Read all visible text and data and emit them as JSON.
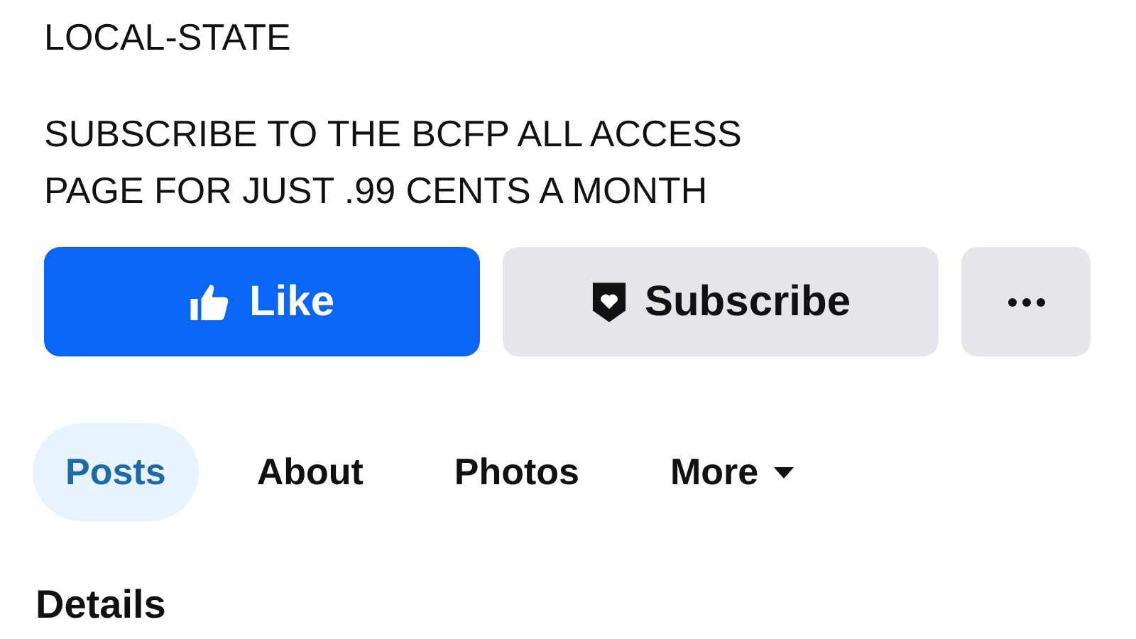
{
  "category": "LOCAL-STATE",
  "description": "SUBSCRIBE TO THE BCFP ALL ACCESS PAGE FOR JUST .99 CENTS A MONTH",
  "actions": [
    {
      "kind": "like",
      "label": "Like"
    },
    {
      "kind": "subscribe",
      "label": "Subscribe"
    },
    {
      "kind": "more"
    }
  ],
  "tabs": [
    {
      "label": "Posts",
      "selected": true,
      "kind": "tab"
    },
    {
      "label": "About",
      "selected": false,
      "kind": "tab"
    },
    {
      "label": "Photos",
      "selected": false,
      "kind": "tab"
    },
    {
      "label": "More",
      "selected": false,
      "kind": "menu"
    }
  ],
  "section_title": "Details"
}
